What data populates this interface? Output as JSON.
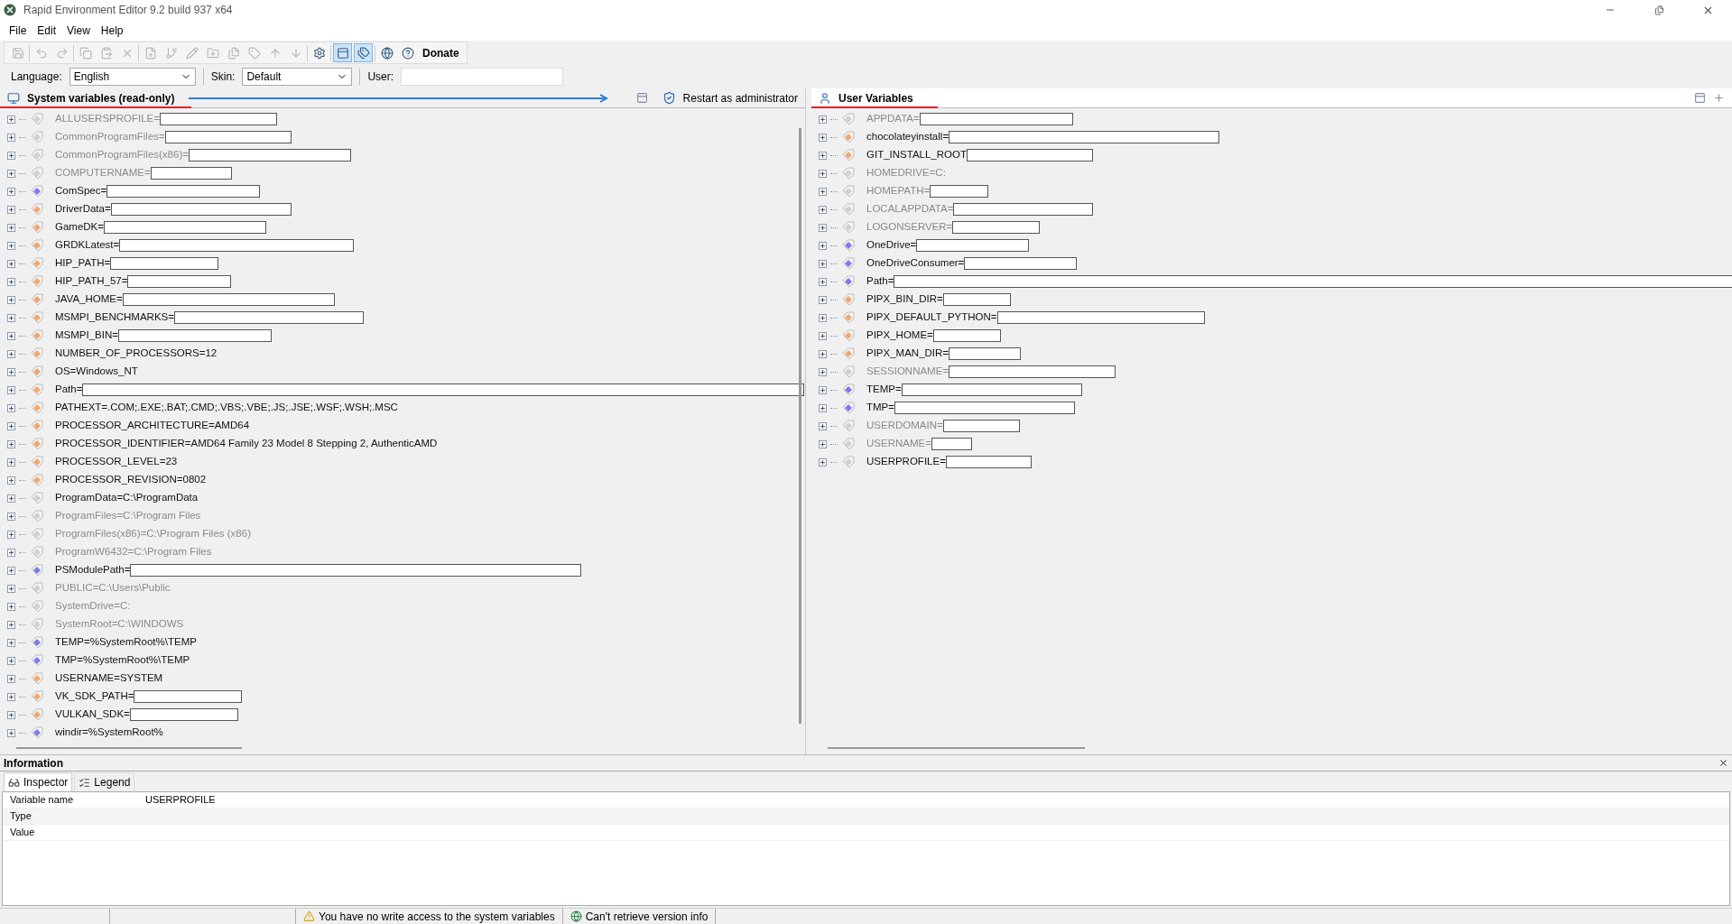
{
  "window": {
    "title": "Rapid Environment Editor 9.2 build 937 x64"
  },
  "menu": [
    "File",
    "Edit",
    "View",
    "Help"
  ],
  "toolbar": {
    "buttons": [
      {
        "disabled": true,
        "selected": false
      },
      {
        "disabled": true,
        "selected": false
      },
      {
        "disabled": true,
        "selected": false
      },
      {
        "disabled": true,
        "selected": false
      },
      {
        "disabled": true,
        "selected": false
      },
      {
        "disabled": true,
        "selected": false
      },
      {
        "disabled": true,
        "selected": false
      },
      {
        "disabled": true,
        "selected": false
      },
      {
        "disabled": true,
        "selected": false
      },
      {
        "disabled": true,
        "selected": false
      },
      {
        "disabled": true,
        "selected": false
      },
      {
        "disabled": true,
        "selected": false
      },
      {
        "disabled": true,
        "selected": false
      },
      {
        "disabled": true,
        "selected": false
      },
      {
        "disabled": false,
        "selected": false
      },
      {
        "disabled": false,
        "selected": true
      },
      {
        "disabled": false,
        "selected": true
      },
      {
        "disabled": false,
        "selected": false
      },
      {
        "disabled": false,
        "selected": false
      }
    ],
    "donate": "Donate"
  },
  "options": {
    "language_label": "Language:",
    "language": "English",
    "skin_label": "Skin:",
    "skin": "Default",
    "user_label": "User:"
  },
  "system_panel": {
    "title": "System variables (read-only)",
    "restart": "Restart as administrator",
    "items": [
      {
        "text": "ALLUSERSPROFILE=",
        "kind": "gray",
        "redacted": true
      },
      {
        "text": "CommonProgramFiles=",
        "kind": "gray",
        "redacted": true
      },
      {
        "text": "CommonProgramFiles(x86)=",
        "kind": "gray",
        "redacted": true
      },
      {
        "text": "COMPUTERNAME=",
        "kind": "gray",
        "redacted": true
      },
      {
        "text": "ComSpec=",
        "kind": "blue",
        "redacted": true
      },
      {
        "text": "DriverData=",
        "kind": "orange",
        "redacted": true
      },
      {
        "text": "GameDK=",
        "kind": "orange",
        "redacted": true
      },
      {
        "text": "GRDKLatest=",
        "kind": "orange",
        "redacted": true
      },
      {
        "text": "HIP_PATH=",
        "kind": "orange",
        "redacted": true
      },
      {
        "text": "HIP_PATH_57=",
        "kind": "orange",
        "redacted": true
      },
      {
        "text": "JAVA_HOME=",
        "kind": "orange",
        "redacted": true
      },
      {
        "text": "MSMPI_BENCHMARKS=",
        "kind": "orange",
        "redacted": true
      },
      {
        "text": "MSMPI_BIN=",
        "kind": "orange",
        "redacted": true
      },
      {
        "text": "NUMBER_OF_PROCESSORS=12",
        "kind": "orange",
        "redacted": false
      },
      {
        "text": "OS=Windows_NT",
        "kind": "orange",
        "redacted": false
      },
      {
        "text": "Path=",
        "kind": "orange",
        "redacted": true
      },
      {
        "text": "PATHEXT=.COM;.EXE;.BAT;.CMD;.VBS;.VBE;.JS;.JSE;.WSF;.WSH;.MSC",
        "kind": "orange",
        "redacted": false
      },
      {
        "text": "PROCESSOR_ARCHITECTURE=AMD64",
        "kind": "orange",
        "redacted": false
      },
      {
        "text": "PROCESSOR_IDENTIFIER=AMD64 Family 23 Model 8 Stepping 2, AuthenticAMD",
        "kind": "orange",
        "redacted": false
      },
      {
        "text": "PROCESSOR_LEVEL=23",
        "kind": "orange",
        "redacted": false
      },
      {
        "text": "PROCESSOR_REVISION=0802",
        "kind": "orange",
        "redacted": false
      },
      {
        "text": "ProgramData=C:\\ProgramData",
        "kind": "gray-dark",
        "redacted": false
      },
      {
        "text": "ProgramFiles=C:\\Program Files",
        "kind": "gray",
        "redacted": false
      },
      {
        "text": "ProgramFiles(x86)=C:\\Program Files (x86)",
        "kind": "gray",
        "redacted": false
      },
      {
        "text": "ProgramW6432=C:\\Program Files",
        "kind": "gray",
        "redacted": false
      },
      {
        "text": "PSModulePath=",
        "kind": "blue",
        "redacted": true
      },
      {
        "text": "PUBLIC=C:\\Users\\Public",
        "kind": "gray",
        "redacted": false
      },
      {
        "text": "SystemDrive=C:",
        "kind": "gray",
        "redacted": false
      },
      {
        "text": "SystemRoot=C:\\WINDOWS",
        "kind": "gray",
        "redacted": false
      },
      {
        "text": "TEMP=%SystemRoot%\\TEMP",
        "kind": "blue",
        "redacted": false
      },
      {
        "text": "TMP=%SystemRoot%\\TEMP",
        "kind": "blue",
        "redacted": false
      },
      {
        "text": "USERNAME=SYSTEM",
        "kind": "orange",
        "redacted": false
      },
      {
        "text": "VK_SDK_PATH=",
        "kind": "orange",
        "redacted": true
      },
      {
        "text": "VULKAN_SDK=",
        "kind": "orange",
        "redacted": true
      },
      {
        "text": "windir=%SystemRoot%",
        "kind": "blue",
        "redacted": false
      }
    ]
  },
  "user_panel": {
    "title": "User Variables",
    "items": [
      {
        "text": "APPDATA=",
        "kind": "gray",
        "redacted": true
      },
      {
        "text": "chocolateyinstall=",
        "kind": "orange",
        "redacted": true
      },
      {
        "text": "GIT_INSTALL_ROOT",
        "kind": "orange",
        "redacted": true
      },
      {
        "text": "HOMEDRIVE=C:",
        "kind": "gray",
        "redacted": false
      },
      {
        "text": "HOMEPATH=",
        "kind": "gray",
        "redacted": true
      },
      {
        "text": "LOCALAPPDATA=",
        "kind": "gray",
        "redacted": true
      },
      {
        "text": "LOGONSERVER=",
        "kind": "gray",
        "redacted": true
      },
      {
        "text": "OneDrive=",
        "kind": "blue",
        "redacted": true
      },
      {
        "text": "OneDriveConsumer=",
        "kind": "blue",
        "redacted": true
      },
      {
        "text": "Path=",
        "kind": "blue",
        "redacted": true
      },
      {
        "text": "PIPX_BIN_DIR=",
        "kind": "orange",
        "redacted": true
      },
      {
        "text": "PIPX_DEFAULT_PYTHON=",
        "kind": "orange",
        "redacted": true
      },
      {
        "text": "PIPX_HOME=",
        "kind": "orange",
        "redacted": true
      },
      {
        "text": "PIPX_MAN_DIR=",
        "kind": "orange",
        "redacted": true
      },
      {
        "text": "SESSIONNAME=",
        "kind": "gray",
        "redacted": true
      },
      {
        "text": "TEMP=",
        "kind": "blue",
        "redacted": true
      },
      {
        "text": "TMP=",
        "kind": "blue",
        "redacted": true
      },
      {
        "text": "USERDOMAIN=",
        "kind": "gray",
        "redacted": true
      },
      {
        "text": "USERNAME=",
        "kind": "gray",
        "redacted": true
      },
      {
        "text": "USERPROFILE=",
        "kind": "gray-dark",
        "redacted": true
      }
    ]
  },
  "information": {
    "title": "Information",
    "tabs": [
      {
        "label": "Inspector",
        "selected": true
      },
      {
        "label": "Legend",
        "selected": false
      }
    ],
    "rows": [
      {
        "label": "Variable name",
        "value": "USERPROFILE"
      },
      {
        "label": "Type"
      },
      {
        "label": "Value"
      }
    ]
  },
  "status_bar": {
    "messages": [
      "You have no write access to the system variables",
      "Can't retrieve version info"
    ]
  }
}
